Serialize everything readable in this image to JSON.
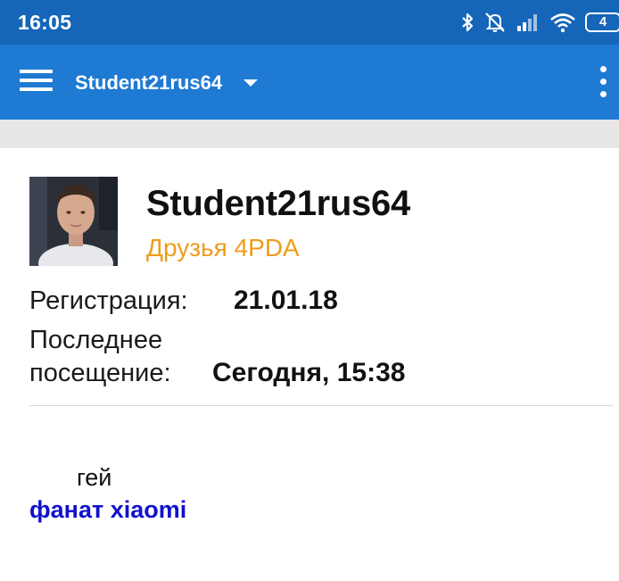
{
  "status_bar": {
    "time": "16:05",
    "icons": [
      "bluetooth-icon",
      "mute-icon",
      "signal-icon",
      "wifi-icon",
      "battery-icon"
    ],
    "battery_level": "4",
    "background": "#1565b8"
  },
  "app_bar": {
    "account_name": "Student21rus64",
    "background": "#1e7ad3",
    "icons": [
      "menu-icon",
      "dropdown-caret-icon",
      "more-vert-icon"
    ]
  },
  "profile": {
    "name": "Student21rus64",
    "group": "Друзья 4PDA",
    "group_color": "#ef9c1a",
    "registration_label": "Регистрация:",
    "registration_value": "21.01.18",
    "last_visit_label_line1": "Последнее",
    "last_visit_label_line2": "посещение:",
    "last_visit_value": "Сегодня, 15:38"
  },
  "signature": {
    "line1": "гей",
    "line2": "фанат xiaomi",
    "line2_color": "#1111cc"
  }
}
